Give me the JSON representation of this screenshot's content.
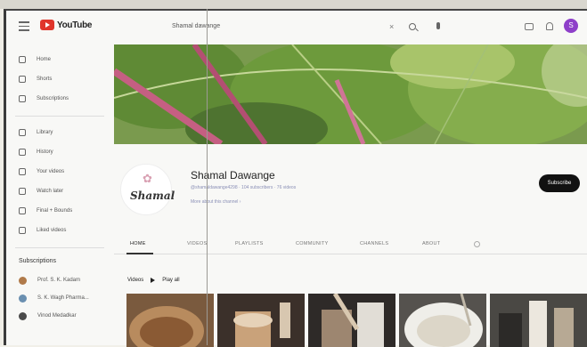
{
  "header": {
    "brand": "YouTube",
    "search_value": "Shamal dawange",
    "search_clear": "×",
    "avatar_letter": "S",
    "accent": "#e0352b",
    "avatar_color": "#8e3fc9"
  },
  "sidebar": {
    "items": [
      {
        "label": "Home",
        "icon": "home-icon"
      },
      {
        "label": "Shorts",
        "icon": "shorts-icon"
      },
      {
        "label": "Subscriptions",
        "icon": "subscriptions-icon"
      },
      {
        "label": "Library",
        "icon": "library-icon"
      },
      {
        "label": "History",
        "icon": "history-icon"
      },
      {
        "label": "Your videos",
        "icon": "your-videos-icon"
      },
      {
        "label": "Watch later",
        "icon": "watch-later-icon"
      },
      {
        "label": "Final + Bounds",
        "icon": "playlist-icon"
      },
      {
        "label": "Liked videos",
        "icon": "like-icon"
      }
    ],
    "subscriptions_heading": "Subscriptions",
    "subscriptions": [
      {
        "label": "Prof. S. K. Kadam",
        "color": "#b07a4a"
      },
      {
        "label": "S. K. Wagh Pharma...",
        "color": "#6a8fb0"
      },
      {
        "label": "Vinod Medadkar",
        "color": "#4a4a4a"
      }
    ]
  },
  "channel": {
    "logo_text": "Shamal",
    "name": "Shamal Dawange",
    "meta": "@shamaldawange4298 · 104 subscribers · 76 videos",
    "more": "More about this channel ›",
    "subscribe_label": "Subscribe"
  },
  "tabs": [
    "HOME",
    "VIDEOS",
    "PLAYLISTS",
    "COMMUNITY",
    "CHANNELS",
    "ABOUT"
  ],
  "videos": {
    "heading": "Videos",
    "play_all": "Play all"
  }
}
